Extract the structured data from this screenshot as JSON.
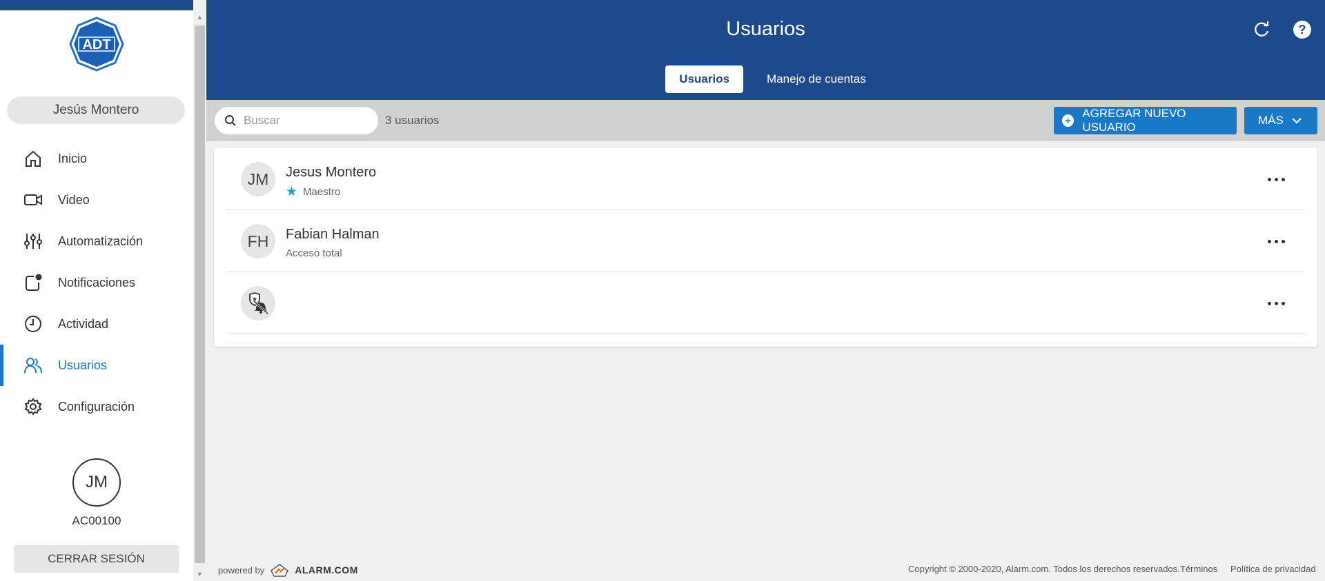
{
  "sidebar": {
    "logo_text": "ADT",
    "user_name": "Jesús Montero",
    "items": [
      {
        "label": "Inicio",
        "icon": "home-icon"
      },
      {
        "label": "Video",
        "icon": "video-camera-icon"
      },
      {
        "label": "Automatización",
        "icon": "sliders-icon"
      },
      {
        "label": "Notificaciones",
        "icon": "notification-icon"
      },
      {
        "label": "Actividad",
        "icon": "clock-icon"
      },
      {
        "label": "Usuarios",
        "icon": "users-icon",
        "active": true
      },
      {
        "label": "Configuración",
        "icon": "gear-icon"
      }
    ],
    "avatar_initials": "JM",
    "account_id": "AC00100",
    "logout_label": "CERRAR SESIÓN"
  },
  "header": {
    "title": "Usuarios",
    "tabs": [
      {
        "label": "Usuarios",
        "active": true
      },
      {
        "label": "Manejo de cuentas",
        "active": false
      }
    ]
  },
  "toolbar": {
    "search_placeholder": "Buscar",
    "user_count": "3 usuarios",
    "add_label": "AGREGAR NUEVO USUARIO",
    "more_label": "MÁS"
  },
  "users": [
    {
      "initials": "JM",
      "name": "Jesus Montero",
      "role": "Maestro",
      "starred": true
    },
    {
      "initials": "FH",
      "name": "Fabian Halman",
      "role": "Acceso total",
      "starred": false
    },
    {
      "initials": "",
      "name": "",
      "role": "",
      "icon": "shield-bell-off-icon"
    }
  ],
  "footer": {
    "powered_by": "powered by",
    "brand": "ALARM.COM",
    "copyright": "Copyright © 2000-2020, Alarm.com. Todos los derechos reservados.",
    "terms": "Términos",
    "privacy": "Política de privacidad"
  },
  "colors": {
    "header_bg": "#1e4a8c",
    "accent": "#1a78c9",
    "star": "#1fa1c9"
  }
}
